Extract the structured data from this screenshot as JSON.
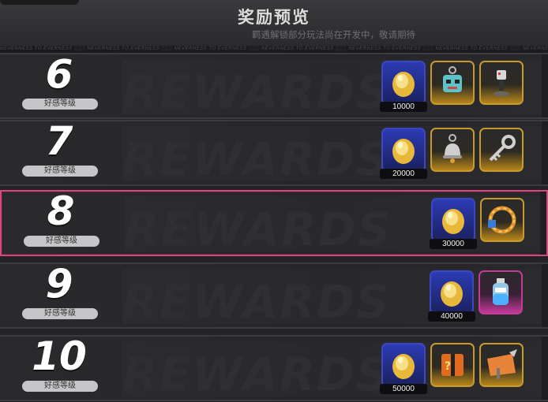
{
  "header": {
    "title": "奖励预览",
    "subtitle": "羁遇解锁部分玩法尚在开发中，敬请期待"
  },
  "ticker_text": "NEVERNESS TO EVERNESS",
  "background_word": "REWARDS",
  "rows": [
    {
      "level": "6",
      "label": "好感等级",
      "quantity": "10000",
      "rewards": [
        "coin-egg",
        "keychain-charm",
        "spotlight-figure"
      ],
      "highlight": false
    },
    {
      "level": "7",
      "label": "好感等级",
      "quantity": "20000",
      "rewards": [
        "coin-egg",
        "bell-charm",
        "silver-key"
      ],
      "highlight": false
    },
    {
      "level": "8",
      "label": "好感等级",
      "quantity": "30000",
      "rewards": [
        "coin-egg",
        "ring-wreath"
      ],
      "highlight": true
    },
    {
      "level": "9",
      "label": "好感等级",
      "quantity": "40000",
      "rewards": [
        "coin-egg",
        "potion-bottle"
      ],
      "highlight": false
    },
    {
      "level": "10",
      "label": "好感等级",
      "quantity": "50000",
      "rewards": [
        "coin-egg",
        "mystery-box",
        "dance-sign"
      ],
      "highlight": false
    }
  ],
  "colors": {
    "highlight_border": "#d24a7e",
    "blue_tier": "#2c3bb4",
    "gold_tier": "#c89a2b",
    "pink_tier": "#c13b97"
  }
}
